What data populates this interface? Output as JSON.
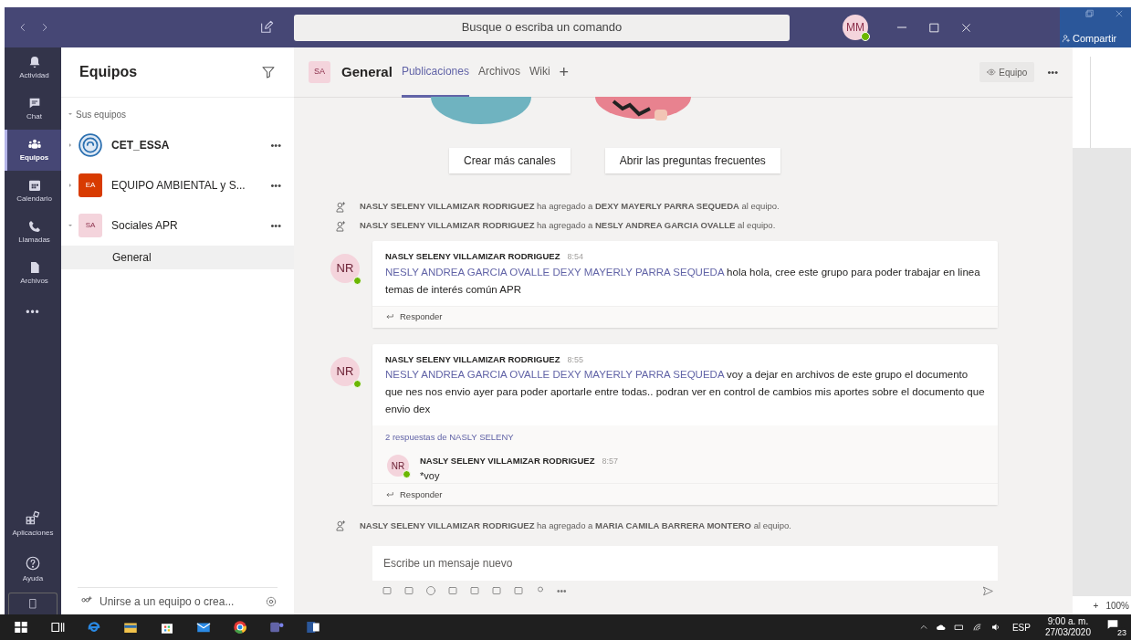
{
  "titlebar": {
    "search_placeholder": "Busque o escriba un comando",
    "user_initials": "MM"
  },
  "rail": {
    "items": [
      {
        "label": "Actividad",
        "kind": "bell",
        "selected": false
      },
      {
        "label": "Chat",
        "kind": "chat",
        "selected": false
      },
      {
        "label": "Equipos",
        "kind": "teams",
        "selected": true
      },
      {
        "label": "Calendario",
        "kind": "calendar",
        "selected": false
      },
      {
        "label": "Llamadas",
        "kind": "phone",
        "selected": false
      },
      {
        "label": "Archivos",
        "kind": "file",
        "selected": false
      }
    ],
    "more": "•••",
    "bottom": [
      {
        "label": "Aplicaciones",
        "kind": "apps"
      },
      {
        "label": "Ayuda",
        "kind": "help"
      }
    ]
  },
  "teams_panel": {
    "title": "Equipos",
    "section": "Sus equipos",
    "join": "Unirse a un equipo o crea...",
    "teams": [
      {
        "name": "CET_ESSA",
        "kind": "logo",
        "color": "#2a6fb0",
        "unread": true,
        "expanded": false,
        "more": "•••"
      },
      {
        "name": "EQUIPO AMBIENTAL y S...",
        "kind": "initials",
        "initials": "EA",
        "color": "#d83b01",
        "unread": false,
        "expanded": false,
        "more": "•••"
      },
      {
        "name": "Sociales APR",
        "kind": "initials",
        "initials": "SA",
        "color": "#f4d4dc",
        "unread": false,
        "expanded": true,
        "more": "•••",
        "channels": [
          {
            "name": "General",
            "selected": true
          }
        ]
      }
    ]
  },
  "channel_header": {
    "team_initials": "SA",
    "channel": "General",
    "tabs": [
      {
        "label": "Publicaciones",
        "selected": true
      },
      {
        "label": "Archivos",
        "selected": false
      },
      {
        "label": "Wiki",
        "selected": false
      }
    ],
    "add_tab": "+",
    "team_button": "Equipo",
    "more": "•••"
  },
  "welcome_buttons": [
    "Crear más canales",
    "Abrir las preguntas frecuentes"
  ],
  "feed": [
    {
      "kind": "system",
      "text": "**NASLY SELENY VILLAMIZAR RODRIGUEZ** ha agregado a **DEXY MAYERLY PARRA SEQUEDA** al equipo."
    },
    {
      "kind": "system",
      "text": "**NASLY SELENY VILLAMIZAR RODRIGUEZ** ha agregado a **NESLY ANDREA GARCIA OVALLE** al equipo."
    },
    {
      "kind": "post",
      "initials": "NR",
      "author": "NASLY SELENY VILLAMIZAR RODRIGUEZ",
      "time": "8:54",
      "mentions": "NESLY ANDREA GARCIA OVALLE DEXY MAYERLY PARRA SEQUEDA",
      "text": "hola hola, cree este grupo para poder trabajar en linea temas de interés común APR",
      "reply": "Responder"
    },
    {
      "kind": "post",
      "initials": "NR",
      "author": "NASLY SELENY VILLAMIZAR RODRIGUEZ",
      "time": "8:55",
      "mentions": "NESLY ANDREA GARCIA OVALLE DEXY MAYERLY PARRA SEQUEDA",
      "text": "voy a dejar en archivos de este grupo el documento que nes nos envio ayer para poder aportarle entre todas.. podran ver en control de cambios mis aportes sobre el documento que envio dex",
      "replies_link": "2 respuestas de NASLY SELENY",
      "replies": [
        {
          "initials": "NR",
          "author": "NASLY SELENY VILLAMIZAR RODRIGUEZ",
          "time": "8:57",
          "text": "*voy"
        }
      ],
      "reply": "Responder"
    },
    {
      "kind": "system",
      "text": "**NASLY SELENY VILLAMIZAR RODRIGUEZ** ha agregado a **MARIA CAMILA BARRERA MONTERO** al equipo."
    }
  ],
  "compose": {
    "placeholder": "Escribe un mensaje nuevo",
    "more": "•••"
  },
  "word": {
    "share": "Compartir",
    "zoom": "100%",
    "zoom_in": "+"
  },
  "taskbar": {
    "language": "ESP",
    "time": "9:00 a. m.",
    "date": "27/03/2020",
    "notifications": "23"
  }
}
